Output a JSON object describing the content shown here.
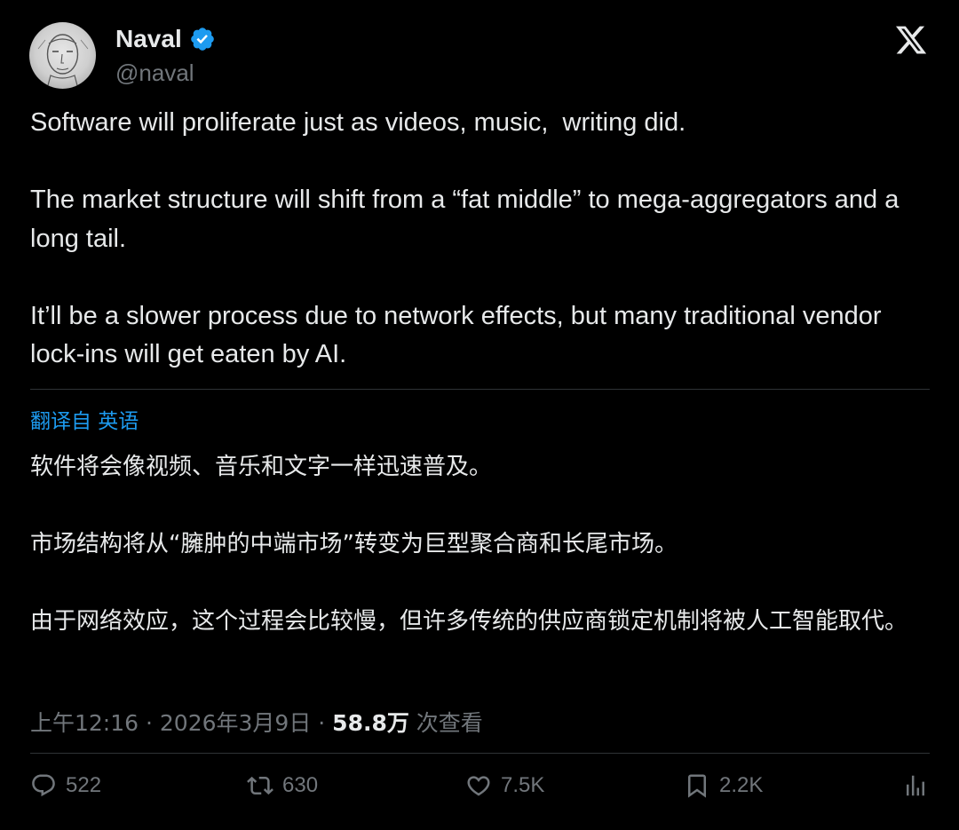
{
  "tweet": {
    "display_name": "Naval",
    "handle": "@naval",
    "paragraphs": [
      "Software will proliferate just as videos, music,  writing did.",
      "The market structure will shift from a “fat middle” to mega-aggregators and a long tail.",
      "It’ll be a slower process due to network effects, but many traditional vendor lock-ins will get eaten by AI."
    ],
    "translate_label": "翻译自 英语",
    "translated_paragraphs": [
      "软件将会像视频、音乐和文字一样迅速普及。",
      "市场结构将从“臃肿的中端市场”转变为巨型聚合商和长尾市场。",
      "由于网络效应，这个过程会比较慢，但许多传统的供应商锁定机制将被人工智能取代。"
    ],
    "time": "上午12:16",
    "separator": " · ",
    "date": "2026年3月9日",
    "views_count": "58.8万",
    "views_label": " 次查看",
    "actions": {
      "reply_count": "522",
      "retweet_count": "630",
      "like_count": "7.5K",
      "bookmark_count": "2.2K"
    }
  },
  "icons": {
    "verified": "verified-badge-icon",
    "brand": "x-logo-icon",
    "reply": "reply-icon",
    "retweet": "retweet-icon",
    "like": "heart-icon",
    "bookmark": "bookmark-icon",
    "analytics": "analytics-icon"
  },
  "colors": {
    "background": "#000000",
    "text": "#e7e9ea",
    "secondary": "#71767b",
    "accent": "#1d9bf0",
    "divider": "#2f3336"
  }
}
